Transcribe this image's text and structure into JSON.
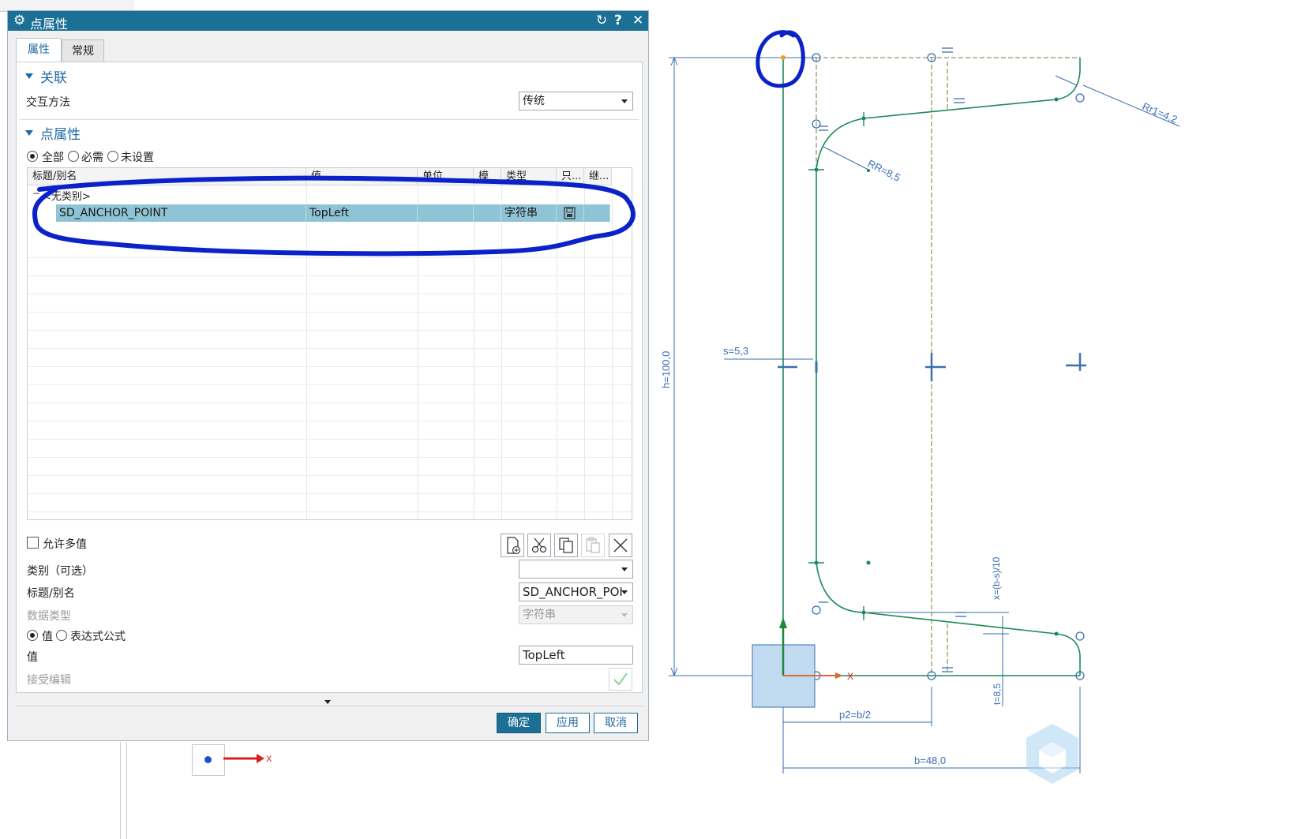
{
  "dialog": {
    "title": "点属性",
    "tabs": [
      "属性",
      "常规"
    ],
    "sections": {
      "association": "关联",
      "point_attributes": "点属性"
    },
    "interaction_method_label": "交互方法",
    "interaction_method_value": "传统",
    "filter_options": [
      "全部",
      "必需",
      "未设置"
    ],
    "table": {
      "headers": [
        "标题/别名",
        "值",
        "单位",
        "模",
        "类型",
        "只...",
        "继..."
      ],
      "group_label": "<无类别>",
      "rows": [
        {
          "title": "SD_ANCHOR_POINT",
          "value": "TopLeft",
          "unit": "",
          "mode": "",
          "type": "字符串"
        }
      ]
    },
    "allow_multiple_label": "允许多值",
    "category_label": "类别（可选）",
    "category_value": "",
    "title_alias_label": "标题/别名",
    "title_alias_value": "SD_ANCHOR_POI",
    "data_type_label": "数据类型",
    "data_type_value": "字符串",
    "value_mode_options": [
      "值",
      "表达式公式"
    ],
    "value_label": "值",
    "value_value": "TopLeft",
    "accept_edit_label": "接受编辑",
    "buttons": {
      "ok": "确定",
      "apply": "应用",
      "cancel": "取消"
    }
  },
  "cad": {
    "dimensions": {
      "height": "h=100,0",
      "web_thickness": "s=5,3",
      "radius_root": "RR=8,5",
      "radius_tip": "Rr1=4,2",
      "slope": "x=(b-s)/10",
      "flange_thickness": "t=8,5",
      "position": "p2=b/2",
      "width": "b=48,0"
    },
    "axis_label": "X",
    "colors": {
      "profile": "#1a8a5a",
      "dimension": "#3a6fb0",
      "annotation": "#0b22c9",
      "dialog_title": "#1c6f95"
    }
  }
}
